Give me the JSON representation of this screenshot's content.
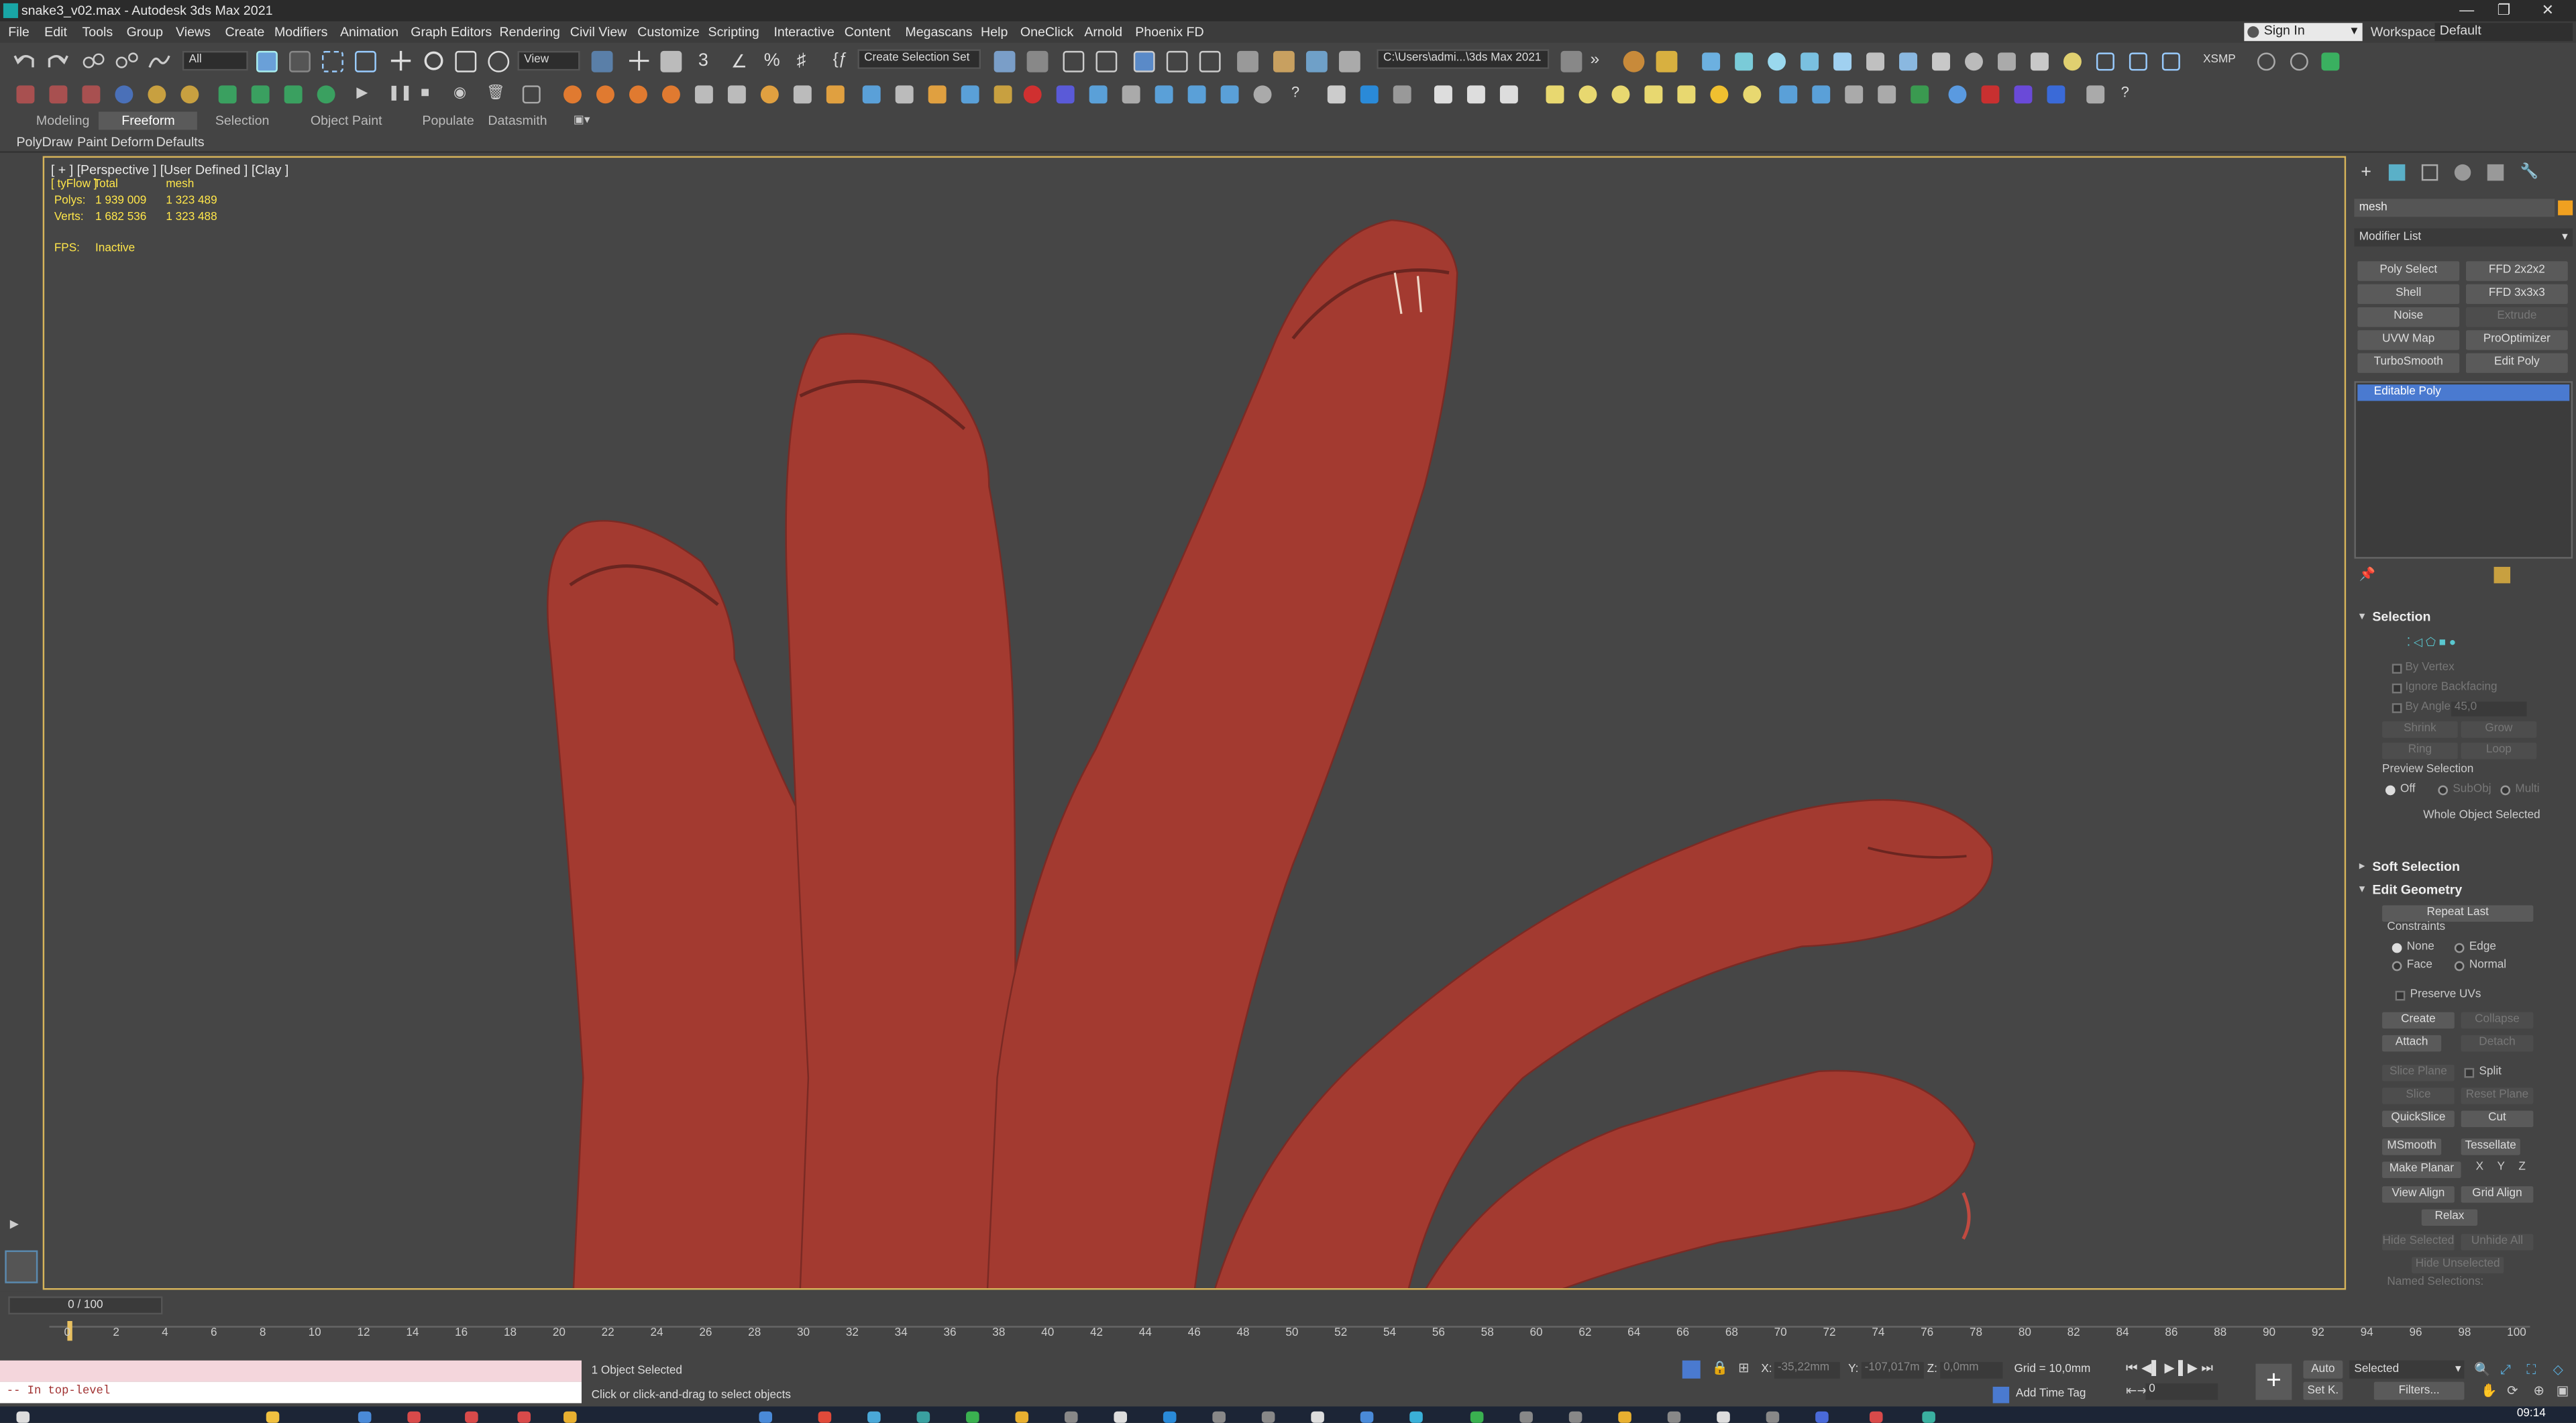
{
  "window": {
    "title": "snake3_v02.max - Autodesk 3ds Max 2021",
    "min": "—",
    "max": "❐",
    "close": "✕"
  },
  "menu": [
    "File",
    "Edit",
    "Tools",
    "Group",
    "Views",
    "Create",
    "Modifiers",
    "Animation",
    "Graph Editors",
    "Rendering",
    "Civil View",
    "Customize",
    "Scripting",
    "Interactive",
    "Content",
    "Megascans",
    "Help",
    "OneClick",
    "Arnold",
    "Phoenix FD"
  ],
  "account": {
    "signin": "Sign In",
    "workspaces_label": "Workspaces:",
    "workspace": "Default"
  },
  "toolbar": {
    "selection_filter": "All",
    "ref_coord": "View",
    "named_selection": "Create Selection Set",
    "project_path": "C:\\Users\\admi...\\3ds Max 2021",
    "xsmp": "XSMP"
  },
  "ribbon": {
    "tabs": [
      "Modeling",
      "Freeform",
      "Selection",
      "Object Paint",
      "Populate",
      "Datasmith"
    ],
    "active": "Freeform",
    "subtabs": [
      "PolyDraw",
      "Paint Deform",
      "Defaults"
    ]
  },
  "viewport": {
    "label": "[ + ] [Perspective ] [User Defined ] [Clay ]",
    "stats": {
      "header_a": "[ tyFlow ]",
      "header_b": "Total",
      "header_c": "mesh",
      "polys_label": "Polys:",
      "polys_total": "1 939 009",
      "polys_mesh": "1 323 489",
      "verts_label": "Verts:",
      "verts_total": "1 682 536",
      "verts_mesh": "1 323 488",
      "fps_label": "FPS:",
      "fps_value": "Inactive"
    },
    "model_color": "#a33a30"
  },
  "command_panel": {
    "object_name": "mesh",
    "object_color": "#f0a020",
    "modifier_list": "Modifier List",
    "modifier_buttons": [
      [
        "Poly Select",
        "FFD 2x2x2"
      ],
      [
        "Shell",
        "FFD 3x3x3"
      ],
      [
        "Noise",
        "Extrude"
      ],
      [
        "UVW Map",
        "ProOptimizer"
      ],
      [
        "TurboSmooth",
        "Edit Poly"
      ]
    ],
    "stack_item": "Editable Poly",
    "selection": {
      "title": "Selection",
      "by_vertex": "By Vertex",
      "ignore_backfacing": "Ignore Backfacing",
      "by_angle": "By Angle:",
      "angle_value": "45,0",
      "shrink": "Shrink",
      "grow": "Grow",
      "ring": "Ring",
      "loop": "Loop",
      "preview": "Preview Selection",
      "off": "Off",
      "subobj": "SubObj",
      "multi": "Multi",
      "whole": "Whole Object Selected"
    },
    "soft_selection": "Soft Selection",
    "edit_geometry": {
      "title": "Edit Geometry",
      "repeat_last": "Repeat Last",
      "constraints": "Constraints",
      "none": "None",
      "edge": "Edge",
      "face": "Face",
      "normal": "Normal",
      "preserve_uvs": "Preserve UVs",
      "create": "Create",
      "collapse": "Collapse",
      "attach": "Attach",
      "detach": "Detach",
      "slice_plane": "Slice Plane",
      "split": "Split",
      "slice": "Slice",
      "reset_plane": "Reset Plane",
      "quickslice": "QuickSlice",
      "cut": "Cut",
      "msmooth": "MSmooth",
      "tessellate": "Tessellate",
      "make_planar": "Make Planar",
      "x": "X",
      "y": "Y",
      "z": "Z",
      "view_align": "View Align",
      "grid_align": "Grid Align",
      "relax": "Relax",
      "hide_selected": "Hide Selected",
      "unhide_all": "Unhide All",
      "hide_unselected": "Hide Unselected",
      "named_selections": "Named Selections:"
    }
  },
  "timeline": {
    "frame": "0 / 100",
    "ticks": [
      "0",
      "2",
      "4",
      "6",
      "8",
      "10",
      "12",
      "14",
      "16",
      "18",
      "20",
      "22",
      "24",
      "26",
      "28",
      "30",
      "32",
      "34",
      "36",
      "38",
      "40",
      "42",
      "44",
      "46",
      "48",
      "50",
      "52",
      "54",
      "56",
      "58",
      "60",
      "62",
      "64",
      "66",
      "68",
      "70",
      "72",
      "74",
      "76",
      "78",
      "80",
      "82",
      "84",
      "86",
      "88",
      "90",
      "92",
      "94",
      "96",
      "98",
      "100"
    ]
  },
  "status": {
    "maxscript": "-- In top-level",
    "selected": "1 Object Selected",
    "prompt": "Click or click-and-drag to select objects",
    "x_label": "X:",
    "x_value": "-35,22mm",
    "y_label": "Y:",
    "y_value": "-107,017m",
    "z_label": "Z:",
    "z_value": "0,0mm",
    "grid": "Grid = 10,0mm",
    "add_time_tag": "Add Time Tag",
    "current_frame": "0",
    "auto": "Auto",
    "set_key": "Set K.",
    "key_filter": "Selected",
    "filters": "Filters...",
    "clock": "09:14"
  }
}
